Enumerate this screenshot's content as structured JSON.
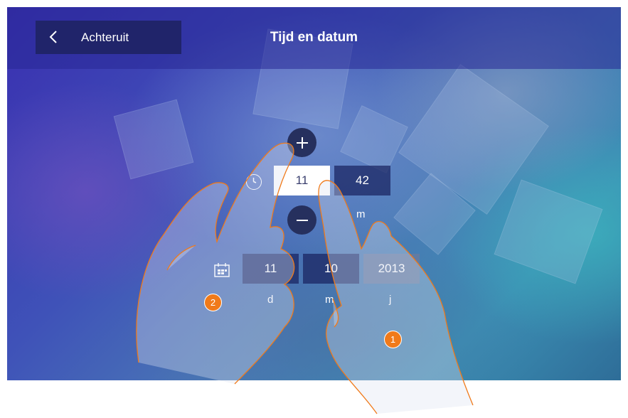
{
  "header": {
    "back_label": "Achteruit",
    "title": "Tijd en datum"
  },
  "time": {
    "hours": "11",
    "minutes": "42",
    "minutes_unit": "m",
    "plus_symbol": "+",
    "minus_symbol": "−"
  },
  "date": {
    "day": "11",
    "month": "10",
    "year": "2013",
    "day_unit": "d",
    "month_unit": "m",
    "year_unit": "j"
  },
  "callouts": [
    "1",
    "2"
  ],
  "icons": {
    "back": "chevron-left-icon",
    "time": "clock-icon",
    "date": "calendar-icon",
    "increment": "plus-icon",
    "decrement": "minus-icon"
  },
  "colors": {
    "topbar": "#2a2a96",
    "back_button": "#20246a",
    "circle_button": "#26305e",
    "callout": "#f07a1a",
    "hand_outline": "#f07a1a"
  }
}
